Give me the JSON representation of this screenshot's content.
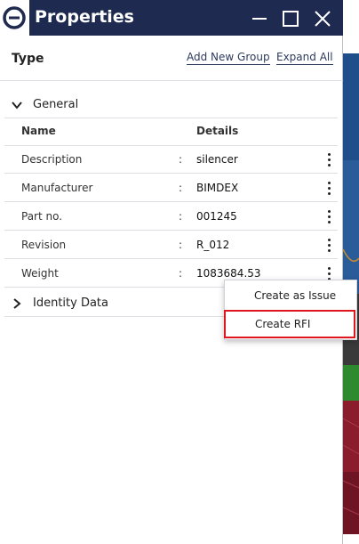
{
  "window": {
    "title": "Properties",
    "icons": [
      "app-logo-icon",
      "minimize-icon",
      "maximize-icon",
      "close-icon"
    ],
    "accent_color": "#1e2a4f"
  },
  "toolbar": {
    "type_label": "Type",
    "add_group_label": "Add New Group",
    "expand_all_label": "Expand All"
  },
  "groups": {
    "general": {
      "label": "General",
      "expanded": true,
      "columns": {
        "name": "Name",
        "details": "Details"
      },
      "rows": [
        {
          "name": "Description",
          "value": "silencer"
        },
        {
          "name": "Manufacturer",
          "value": "BIMDEX"
        },
        {
          "name": "Part no.",
          "value": "001245"
        },
        {
          "name": "Revision",
          "value": "R_012"
        },
        {
          "name": "Weight",
          "value": "1083684.53"
        }
      ],
      "separator": ":"
    },
    "identity": {
      "label": "Identity Data",
      "expanded": false
    }
  },
  "context_menu": {
    "items": [
      {
        "label": "Create as Issue"
      },
      {
        "label": "Create RFI",
        "highlighted": true
      }
    ],
    "highlight_color": "#e0161e"
  }
}
